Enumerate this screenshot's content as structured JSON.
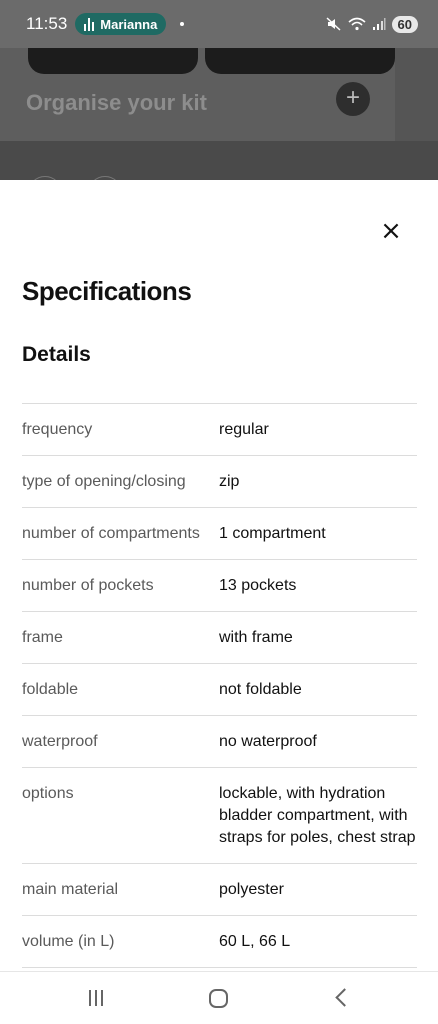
{
  "status_bar": {
    "time": "11:53",
    "call_name": "Marianna",
    "battery": "60"
  },
  "background": {
    "hero_title": "Organise your kit"
  },
  "sheet": {
    "close_glyph": "×",
    "title": "Specifications",
    "section_title": "Details",
    "specs": [
      {
        "label": "frequency",
        "value": "regular"
      },
      {
        "label": "type of opening/closing",
        "value": "zip"
      },
      {
        "label": "number of compartments",
        "value": "1 compartment"
      },
      {
        "label": "number of pockets",
        "value": "13 pockets"
      },
      {
        "label": "frame",
        "value": "with frame"
      },
      {
        "label": "foldable",
        "value": "not foldable"
      },
      {
        "label": "waterproof",
        "value": "no waterproof"
      },
      {
        "label": "options",
        "value": "lockable, with hydration bladder compartment, with straps for poles, chest strap"
      },
      {
        "label": "main material",
        "value": "polyester"
      },
      {
        "label": "volume (in L)",
        "value": "60 L, 66 L"
      },
      {
        "label": "",
        "value": ""
      }
    ]
  },
  "colors": {
    "call_pill": "#1f6a63",
    "scrim": "#555555"
  }
}
